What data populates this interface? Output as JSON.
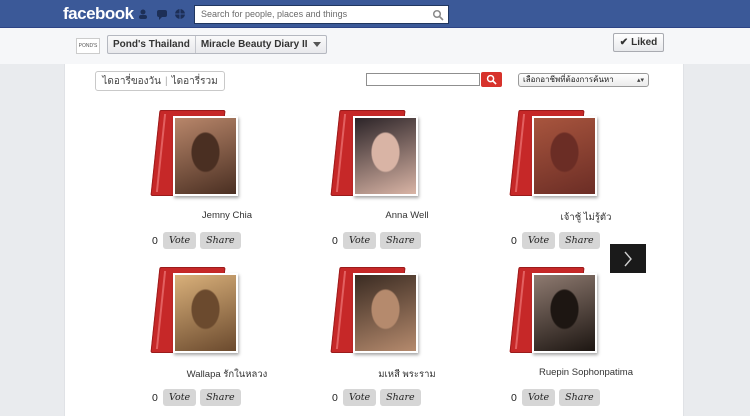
{
  "header": {
    "logo": "facebook",
    "search_placeholder": "Search for people, places and things"
  },
  "page": {
    "thumb_text": "POND'S",
    "crumb_page": "Pond's Thailand",
    "crumb_app": "Miracle Beauty Diary II",
    "liked_label": "Liked"
  },
  "app": {
    "tab_today": "ไดอารี่ของวัน",
    "tab_all": "ไดอารี่รวม",
    "search_value": "",
    "occupation_select": "เลือกอาชีพที่ต้องการค้นหา",
    "vote_label": "Vote",
    "share_label": "Share",
    "entries": [
      {
        "name": "Jemny Chia",
        "votes": "0",
        "colors": [
          "#b8866a",
          "#4a2f22"
        ]
      },
      {
        "name": "Anna Well",
        "votes": "0",
        "colors": [
          "#2c2428",
          "#d9b4a5"
        ]
      },
      {
        "name": "เจ้าชู้ ไม่รู้ตัว",
        "votes": "0",
        "colors": [
          "#a8553e",
          "#6b2d25"
        ]
      },
      {
        "name": "Wallapa รักในหลวง",
        "votes": "0",
        "colors": [
          "#d9b07a",
          "#6b4a2e"
        ]
      },
      {
        "name": "มเหสี พระราม",
        "votes": "0",
        "colors": [
          "#3a2b22",
          "#b58a6d"
        ]
      },
      {
        "name": "Ruepin Sophonpatima",
        "votes": "0",
        "colors": [
          "#8e7a70",
          "#1d1612"
        ]
      }
    ]
  }
}
